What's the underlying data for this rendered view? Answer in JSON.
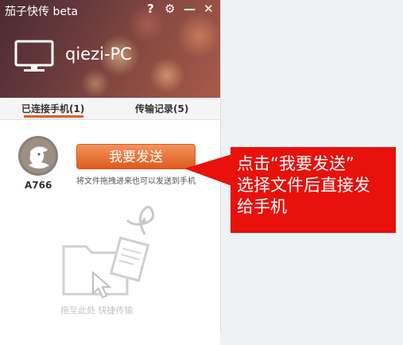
{
  "app": {
    "title": "茄子快传 beta",
    "header_icons": [
      "help-icon",
      "gear-icon",
      "minimize-icon",
      "close-icon"
    ],
    "help_glyph": "?",
    "gear_glyph": "⚙",
    "minimize_glyph": "—",
    "close_glyph": "✕"
  },
  "device_header": {
    "pc_name": "qiezi-PC"
  },
  "tabs": [
    {
      "label": "已连接手机(1)",
      "active": true
    },
    {
      "label": "传输记录(5)",
      "active": false
    }
  ],
  "device": {
    "name": "A766",
    "send_label": "我要发送",
    "hint": "将文件拖拽进来也可以发送到手机"
  },
  "drop_zone": {
    "text": "拖至此处 快捷传输"
  },
  "callout": {
    "line1": "点击“我要发送”",
    "line2": "选择文件后直接发",
    "line3": "给手机"
  },
  "colors": {
    "accent": "#e85c1f",
    "callout": "#e8110b",
    "button_top": "#f3935b",
    "button_bottom": "#df5a20"
  }
}
